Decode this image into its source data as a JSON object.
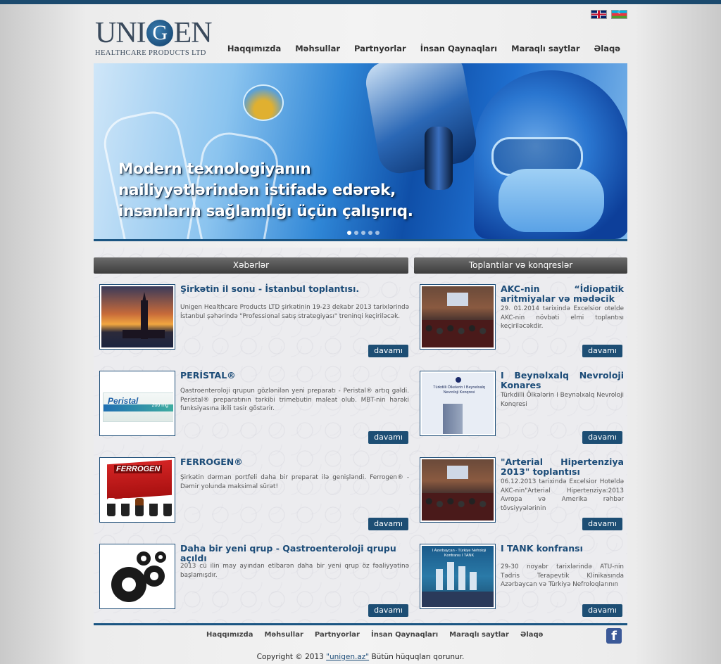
{
  "header": {
    "logo_main_before": "UNI",
    "logo_main_g": "G",
    "logo_main_after": "EN",
    "logo_sub": "HEALTHCARE PRODUCTS LTD",
    "nav": [
      "Haqqımızda",
      "Məhsullar",
      "Partnyorlar",
      "İnsan Qaynaqları",
      "Maraqlı saytlar",
      "Əlaqə"
    ]
  },
  "banner": {
    "line1": "Modern texnologiyanın",
    "line2": "nailiyyətlərindən istifadə edərək,",
    "line3": "insanların sağlamlığı üçün çalışırıq.",
    "slides_total": 5,
    "active_slide": 1
  },
  "news": {
    "heading": "Xəbərlər",
    "items": [
      {
        "title": "Şirkətin il sonu - İstanbul toplantısı.",
        "text": "Unigen Healthcare Products LTD şirkətinin 19-23 dekabr 2013 tarixlərində İstanbul şəhərində \"Professional satış strategiyası\" treninqi keçiriləcək.",
        "more": "davamı"
      },
      {
        "title": "PERİSTAL®",
        "text": "Qastroenteroloji qrupun gözlənilən yeni preparatı - Peristal® artıq gəldi. Peristal® preparatının tərkibi trimebutin maleat olub. MBT-nin hərəki funksiyasına ikili təsir göstərir.",
        "more": "davamı"
      },
      {
        "title": "FERROGEN®",
        "text": "Şirkətin dərman portfeli daha bir preparat ilə genişləndi. Ferrogen® - Dəmir yolunda maksimal sürət!",
        "more": "davamı"
      },
      {
        "title": "Daha bir yeni qrup - Qastroenteroloji qrupu açıldı",
        "text": "2013 cü ilin may ayından etibarən daha bir yeni qrup öz fəaliyyətinə başlamışdır.",
        "more": "davamı"
      }
    ]
  },
  "events": {
    "heading": "Toplantılar və konqreslər",
    "items": [
      {
        "title": "AKC-nin “İdiopatik aritmiyalar və mədəcik",
        "text": "29. 01.2014 tarixində Excelsior otelde AKC-nin növbəti elmi toplantısı keçiriləcəkdir.",
        "more": "davamı"
      },
      {
        "title": "I Beynəlxalq Nevroloji Konares",
        "text": "Türkdilli Ölkələrin I Beynəlxalq Nevroloji Konqresi",
        "more": "davamı"
      },
      {
        "title": "\"Arterial Hipertenziya 2013\" toplantısı",
        "text": "06.12.2013 tarixində Excelsior Hoteldə AKC-nin\"Arterial Hipertenziya:2013 Avropa və Amerika rəhbər tövsiyyələrinin",
        "more": "davamı"
      },
      {
        "title": "I TANK konfransı",
        "text": "29-30 noyabr tarixlərində ATU-nin Tədris Terapevtik Klinikasında Azərbaycan və Türkiyə Nefroloqlarının",
        "more": "davamı"
      }
    ]
  },
  "thumbs": {
    "peristal_name": "Peristal",
    "peristal_dose": "200 mg",
    "ferrogen_name": "FERROGEN",
    "nevro_text": "Türkdilli Ölkelerin I Beynelxalq Nevroloji Konqresi",
    "tank_text": "I Azerbaycan - Türkiye Nefroloji Konfransı I TANK"
  },
  "footer": {
    "nav": [
      "Haqqımızda",
      "Məhsullar",
      "Partnyorlar",
      "İnsan Qaynaqları",
      "Maraqlı saytlar",
      "Əlaqə"
    ],
    "facebook": "f",
    "copy_before": "Copyright © 2013",
    "copy_link": "\"unigen.az\"",
    "copy_after": "Bütün hüquqları qorunur."
  },
  "colors": {
    "brand_blue": "#1b4a6e",
    "button_blue": "#1d4e74",
    "title_blue": "#1c4c78"
  }
}
